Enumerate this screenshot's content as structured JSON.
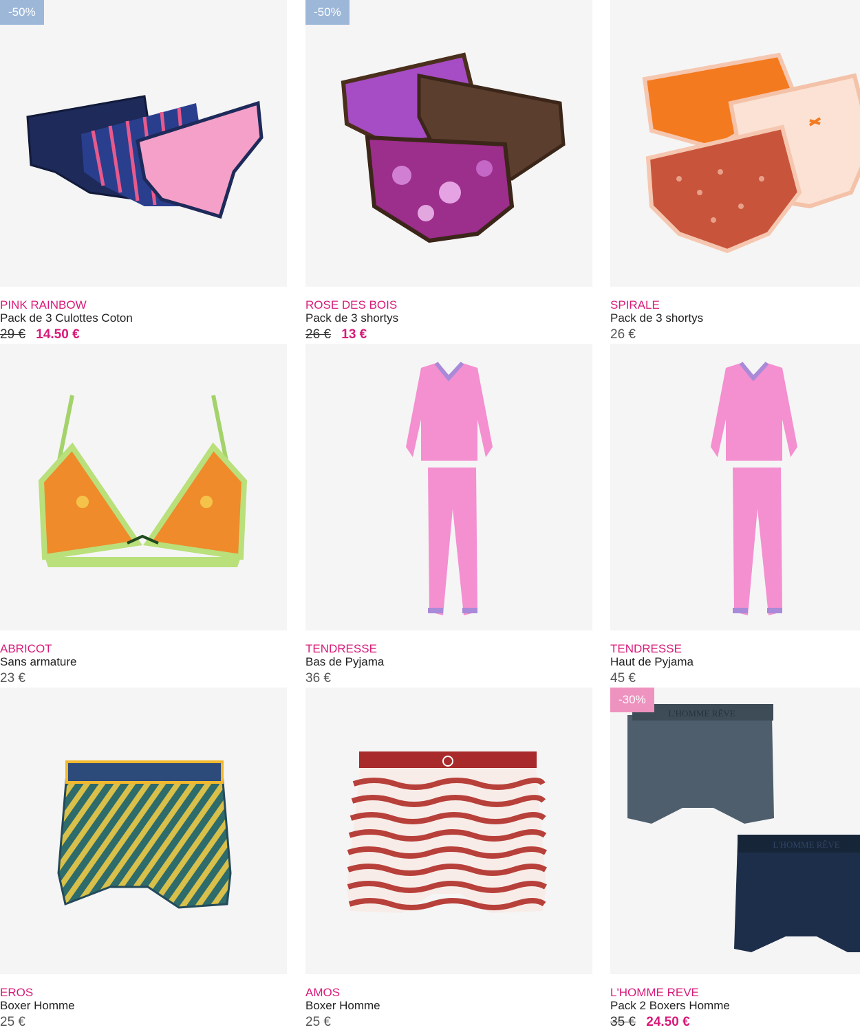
{
  "products": [
    {
      "brand": "PINK RAINBOW",
      "title": "Pack de 3 Culottes Coton",
      "old_price": "29 €",
      "price": "14.50 €",
      "badge": "-50%",
      "badge_color": "#9db7d9",
      "image": "three-briefs-navy-stripes-pink"
    },
    {
      "brand": "ROSE DES BOIS",
      "title": "Pack de 3 shortys",
      "old_price": "26 €",
      "price": "13 €",
      "badge": "-50%",
      "badge_color": "#9db7d9",
      "image": "three-shortys-purple-brown"
    },
    {
      "brand": "SPIRALE",
      "title": "Pack de 3 shortys",
      "price": "26 €",
      "image": "three-shortys-orange-peach"
    },
    {
      "brand": "ABRICOT",
      "title": "Sans armature",
      "price": "23 €",
      "image": "bralette-orange-green-lace"
    },
    {
      "brand": "TENDRESSE",
      "title": "Bas de Pyjama",
      "price": "36 €",
      "image": "pink-pyjama-set"
    },
    {
      "brand": "TENDRESSE",
      "title": "Haut de Pyjama",
      "price": "45 €",
      "image": "pink-pyjama-set"
    },
    {
      "brand": "EROS",
      "title": "Boxer Homme",
      "price": "25 €",
      "image": "boxer-blue-yellow-stripes"
    },
    {
      "brand": "AMOS",
      "title": "Boxer Homme",
      "price": "25 €",
      "image": "boxer-red-white-waves"
    },
    {
      "brand": "L'HOMME REVE",
      "title": "Pack 2 Boxers Homme",
      "old_price": "35 €",
      "price": "24.50 €",
      "badge": "-30%",
      "badge_color": "#ee92bf",
      "image": "two-boxers-grey-navy",
      "waistband_text": "L'HOMME RÊVE"
    }
  ],
  "colors": {
    "brand": "#d81b7a",
    "image_bg": "#f5f5f5"
  }
}
